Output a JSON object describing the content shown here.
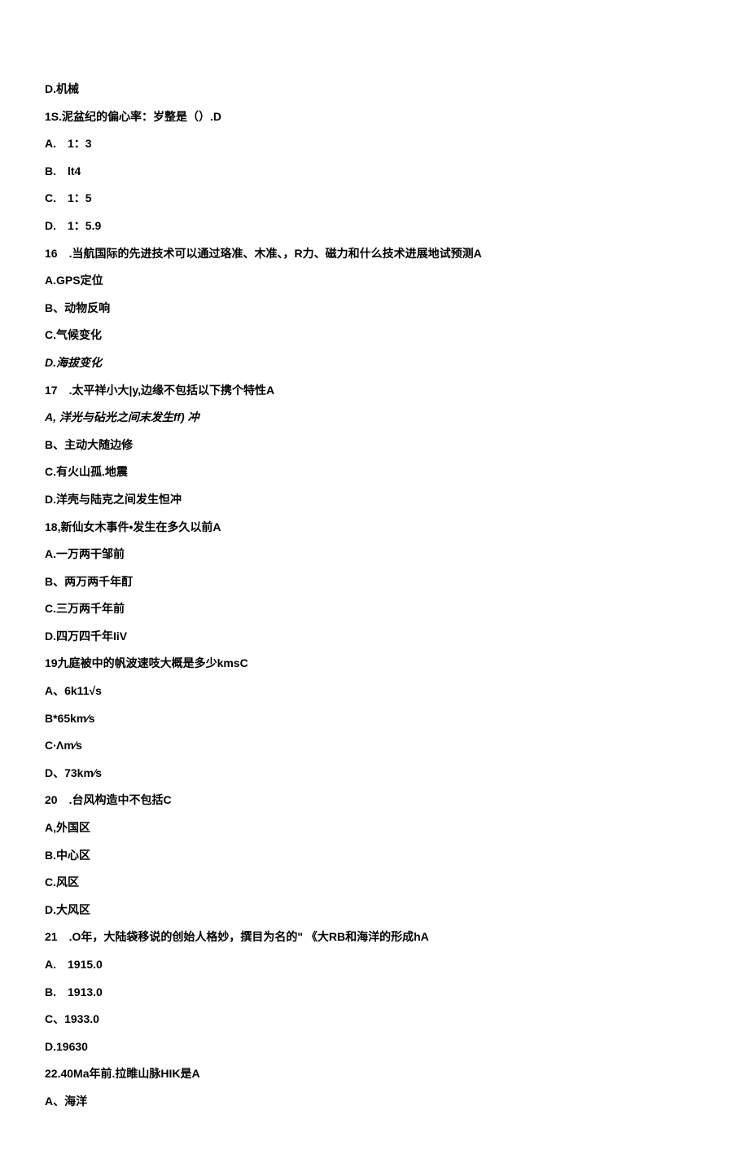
{
  "lines": [
    {
      "text": "D.机械",
      "italic": false,
      "indent": false
    },
    {
      "text": "1S.泥盆纪的偏心率：岁整是（）.D",
      "italic": false,
      "indent": false
    },
    {
      "text": "A.　1：3",
      "italic": false,
      "indent": false
    },
    {
      "text": "B.　lt4",
      "italic": false,
      "indent": false
    },
    {
      "text": "C.　1：5",
      "italic": false,
      "indent": false
    },
    {
      "text": "D.　1：5.9",
      "italic": false,
      "indent": false
    },
    {
      "text": "16　.当航国际的先进技术可以通过珞准、木准、，R力、磁力和什么技术进展地试预测A",
      "italic": false,
      "indent": false
    },
    {
      "text": "A.GPS定位",
      "italic": false,
      "indent": false
    },
    {
      "text": "B、动物反响",
      "italic": false,
      "indent": false
    },
    {
      "text": "C.气候变化",
      "italic": false,
      "indent": false
    },
    {
      "text": "D.海拔变化",
      "italic": true,
      "indent": false
    },
    {
      "text": "17　.太平祥小大|y,边缘不包括以下携个特性A",
      "italic": false,
      "indent": false
    },
    {
      "text": "A,  洋光与砧光之间末发生ff)  冲",
      "italic": true,
      "indent": false
    },
    {
      "text": "B、主动大随边修",
      "italic": false,
      "indent": false
    },
    {
      "text": "C.有火山孤.地震",
      "italic": false,
      "indent": false
    },
    {
      "text": "D.洋壳与陆克之间发生怛冲",
      "italic": false,
      "indent": false
    },
    {
      "text": "18,新仙女木事件•发生在多久以前A",
      "italic": false,
      "indent": false
    },
    {
      "text": "A.一万两干邹前",
      "italic": false,
      "indent": false
    },
    {
      "text": "B、两万两千年酊",
      "italic": false,
      "indent": false
    },
    {
      "text": "C.三万两千年前",
      "italic": false,
      "indent": false
    },
    {
      "text": "D.四万四千年IiV",
      "italic": false,
      "indent": false
    },
    {
      "text": "19九庭被中的帆波速吱大概是多少kmsC",
      "italic": false,
      "indent": false
    },
    {
      "text": "A、6k11√s",
      "italic": false,
      "indent": false
    },
    {
      "text": "B*65km∕s",
      "italic": false,
      "indent": false
    },
    {
      "text": "C∙Λm∕s",
      "italic": false,
      "indent": false
    },
    {
      "text": "D、73km∕s",
      "italic": false,
      "indent": false
    },
    {
      "text": "20　.台风构造中不包括C",
      "italic": false,
      "indent": false
    },
    {
      "text": "A,外国区",
      "italic": false,
      "indent": false
    },
    {
      "text": "B.中心区",
      "italic": false,
      "indent": false
    },
    {
      "text": "C.风区",
      "italic": false,
      "indent": false
    },
    {
      "text": "D.大风区",
      "italic": false,
      "indent": false
    },
    {
      "text": "21　.O年，大陆袋移说的创始人格妙，撰目为名的\"  《大RB和海洋的形成hA",
      "italic": false,
      "indent": false
    },
    {
      "text": "A.　1915.0",
      "italic": false,
      "indent": false
    },
    {
      "text": "B.　1913.0",
      "italic": false,
      "indent": false
    },
    {
      "text": "C、1933.0",
      "italic": false,
      "indent": false
    },
    {
      "text": "D.19630",
      "italic": false,
      "indent": false
    },
    {
      "text": "22.40Ma年前.拉睢山脉HIK是A",
      "italic": false,
      "indent": false
    },
    {
      "text": "A、海洋",
      "italic": false,
      "indent": false
    }
  ]
}
